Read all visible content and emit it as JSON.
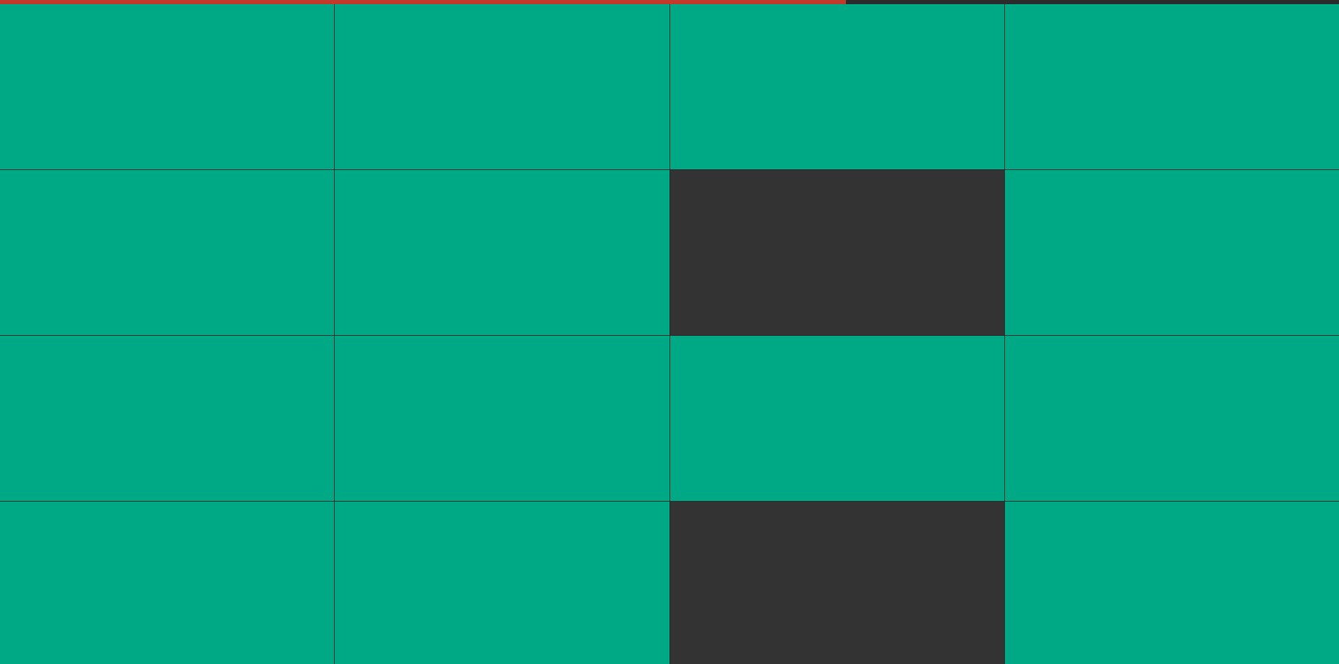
{
  "timer": {
    "remaining_fraction": 0.632,
    "fill_color": "#c0392b",
    "track_color": "#2b2b2b"
  },
  "board": {
    "rows": 4,
    "columns": 4,
    "tile_colors": {
      "green": "#00a986",
      "dark": "#333333"
    },
    "tiles": [
      [
        "green",
        "green",
        "green",
        "green"
      ],
      [
        "green",
        "green",
        "dark",
        "green"
      ],
      [
        "green",
        "green",
        "green",
        "green"
      ],
      [
        "green",
        "green",
        "dark",
        "green"
      ]
    ]
  }
}
